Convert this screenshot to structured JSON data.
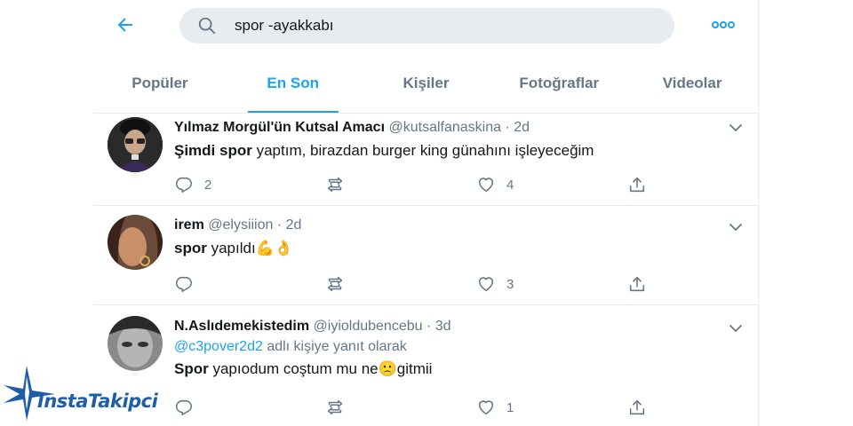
{
  "search": {
    "query": "spor -ayakkabı",
    "icons": {
      "back": "arrow-left-icon",
      "search": "search-icon",
      "more": "more-dots-icon"
    }
  },
  "tabs": [
    {
      "label": "Popüler",
      "active": false
    },
    {
      "label": "En Son",
      "active": true
    },
    {
      "label": "Kişiler",
      "active": false
    },
    {
      "label": "Fotoğraflar",
      "active": false
    },
    {
      "label": "Videolar",
      "active": false
    }
  ],
  "tweets": [
    {
      "name": "Yılmaz Morgül'ün Kutsal Amacı",
      "handle": "@kutsalfanaskina",
      "sep": "·",
      "time": "2d",
      "text_bold": "Şimdi spor",
      "text_rest": "yaptım, birazdan burger king günahını işleyeceğim",
      "replies": "2",
      "retweets": "",
      "likes": "4"
    },
    {
      "name": "irem",
      "handle": "@elysiiion",
      "sep": "·",
      "time": "2d",
      "text_bold": "spor",
      "text_rest": "yapıldı💪👌",
      "replies": "",
      "retweets": "",
      "likes": "3"
    },
    {
      "name": "N.Aslıdemekistedim",
      "handle": "@iyioldubencebu",
      "sep": "·",
      "time": "3d",
      "reply_mention": "@c3pover2d2",
      "reply_suffix": "adlı kişiye yanıt olarak",
      "text_bold": "Spor",
      "text_rest": "yapıodum coştum mu ne🙁gitmii",
      "replies": "",
      "retweets": "",
      "likes": "1"
    }
  ],
  "watermark": {
    "text": "InstaTakipci"
  },
  "colors": {
    "accent": "#1da1f2",
    "muted": "#657786",
    "search_bg": "#e6ecf0",
    "watermark": "#1e5ea8"
  }
}
